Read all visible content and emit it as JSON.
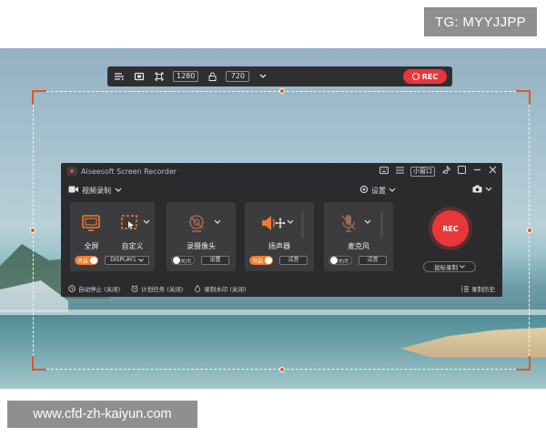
{
  "watermarks": {
    "tg": "TG: MYYJJPP",
    "url": "www.cfd-zh-kaiyun.com"
  },
  "selection_toolbar": {
    "width_value": "1280",
    "height_value": "720",
    "rec_label": "REC"
  },
  "app": {
    "title": "Aiseesoft Screen Recorder",
    "mini_window_label": "小窗口",
    "mode_label": "视频录制",
    "settings_label": "设置",
    "panels": {
      "display": {
        "full_label": "全屏",
        "custom_label": "自定义",
        "toggle_label": "开启",
        "display_select": "DISPLAY1"
      },
      "webcam": {
        "label": "录摄像头",
        "toggle_label": "关闭",
        "settings_button": "设置"
      },
      "speaker": {
        "label": "扬声器",
        "toggle_label": "开启",
        "test_button": "试音"
      },
      "mic": {
        "label": "麦克风",
        "toggle_label": "关闭",
        "test_button": "试音"
      }
    },
    "rec_button": "REC",
    "cursor_record_label": "鼠标录制",
    "status": {
      "auto_stop": "自动停止 (关闭)",
      "schedule": "计划任务 (关闭)",
      "watermark": "录制水印 (关闭)",
      "history": "录制历史"
    }
  },
  "colors": {
    "accent": "#f07b2c",
    "rec": "#e8373b",
    "app_bg": "#2b2b2e",
    "panel_bg": "#3c3c3f",
    "selection_handle": "#e2562a"
  },
  "icons": [
    "menu-icon",
    "screen-region-icon",
    "crop-icon",
    "lock-icon",
    "chevron-down-icon",
    "keyboard-icon",
    "list-icon",
    "pin-icon",
    "minimize-icon",
    "close-icon",
    "video-camera-icon",
    "gear-icon",
    "camera-icon",
    "monitor-icon",
    "custom-region-icon",
    "webcam-icon",
    "speaker-icon",
    "microphone-icon",
    "clock-icon",
    "alarm-icon",
    "watermark-icon",
    "history-icon",
    "move-cursor-icon"
  ]
}
